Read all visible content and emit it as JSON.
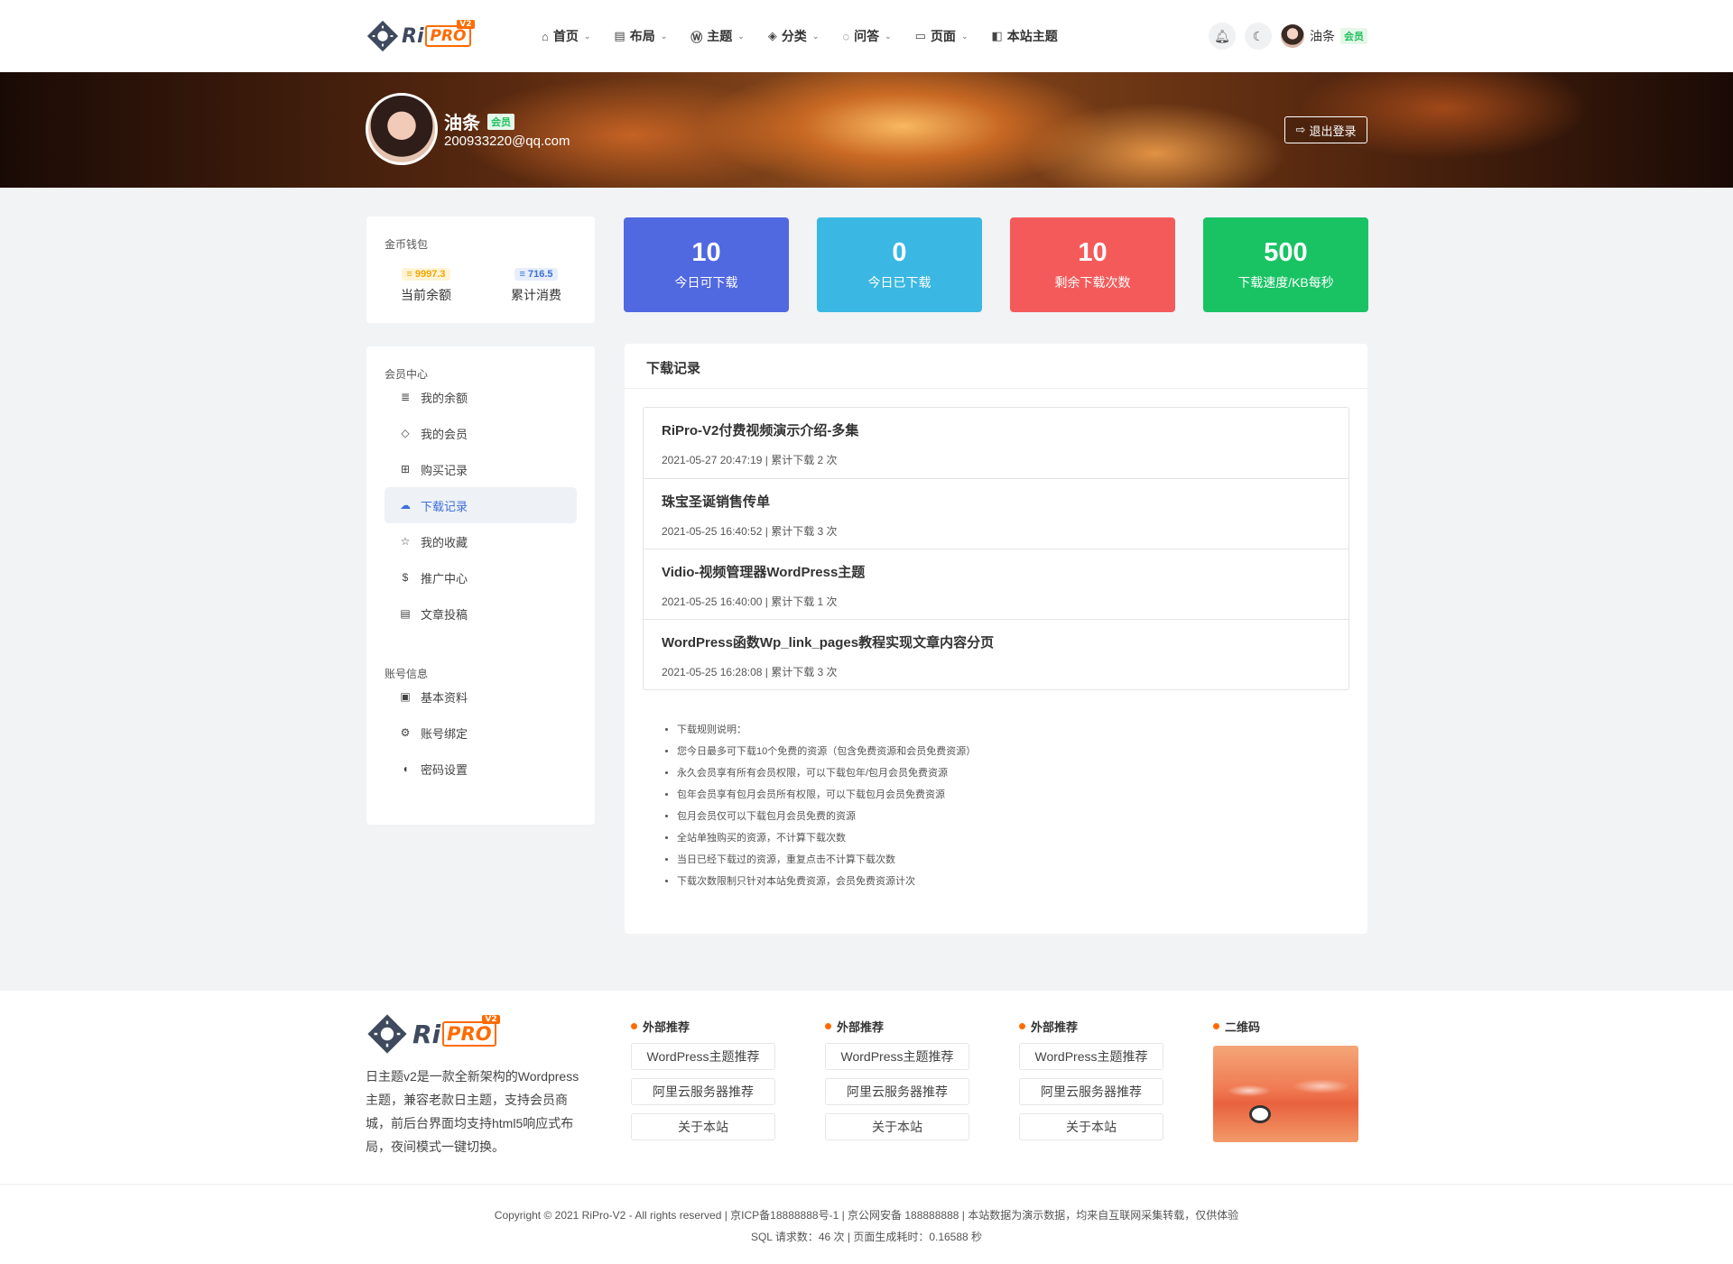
{
  "brand": {
    "ri": "Ri",
    "pro": "PRO",
    "version": "V2"
  },
  "nav": {
    "items": [
      {
        "label": "首页",
        "icon": "home-icon",
        "glyph": "⌂",
        "dropdown": true
      },
      {
        "label": "布局",
        "icon": "file-icon",
        "glyph": "▤",
        "dropdown": true
      },
      {
        "label": "主题",
        "icon": "wordpress-icon",
        "glyph": "Ⓦ",
        "dropdown": true
      },
      {
        "label": "分类",
        "icon": "layers-icon",
        "glyph": "◈",
        "dropdown": true
      },
      {
        "label": "问答",
        "icon": "chat-icon",
        "glyph": "◌",
        "dropdown": true
      },
      {
        "label": "页面",
        "icon": "window-icon",
        "glyph": "▭",
        "dropdown": true
      },
      {
        "label": "本站主题",
        "icon": "bag-icon",
        "glyph": "◧",
        "dropdown": false
      }
    ],
    "user_name": "油条",
    "user_badge": "会员"
  },
  "profile": {
    "name": "油条",
    "badge": "会员",
    "email": "200933220@qq.com",
    "logout_label": "退出登录"
  },
  "wallet": {
    "title": "金币钱包",
    "balance_value": "9997.3",
    "balance_label": "当前余额",
    "spent_value": "716.5",
    "spent_label": "累计消费"
  },
  "sidebar": {
    "member_title": "会员中心",
    "member_items": [
      {
        "label": "我的余额",
        "icon": "coins-icon",
        "glyph": "≣"
      },
      {
        "label": "我的会员",
        "icon": "diamond-icon",
        "glyph": "◇"
      },
      {
        "label": "购买记录",
        "icon": "basket-icon",
        "glyph": "⊞"
      },
      {
        "label": "下载记录",
        "icon": "cloud-download-icon",
        "glyph": "☁"
      },
      {
        "label": "我的收藏",
        "icon": "star-icon",
        "glyph": "☆"
      },
      {
        "label": "推广中心",
        "icon": "hand-coin-icon",
        "glyph": "$"
      },
      {
        "label": "文章投稿",
        "icon": "newspaper-icon",
        "glyph": "▤"
      }
    ],
    "account_title": "账号信息",
    "account_items": [
      {
        "label": "基本资料",
        "icon": "id-card-icon",
        "glyph": "▣"
      },
      {
        "label": "账号绑定",
        "icon": "user-cog-icon",
        "glyph": "⚙"
      },
      {
        "label": "密码设置",
        "icon": "shield-icon",
        "glyph": "◖"
      }
    ]
  },
  "stats": [
    {
      "value": "10",
      "label": "今日可下载",
      "color": "#5068e0"
    },
    {
      "value": "0",
      "label": "今日已下载",
      "color": "#3ab7e2"
    },
    {
      "value": "10",
      "label": "剩余下载次数",
      "color": "#f55a5a"
    },
    {
      "value": "500",
      "label": "下载速度/KB每秒",
      "color": "#19c364"
    }
  ],
  "records": {
    "title": "下载记录",
    "items": [
      {
        "title": "RiPro-V2付费视频演示介绍-多集",
        "meta": "2021-05-27 20:47:19 | 累计下载 2 次"
      },
      {
        "title": "珠宝圣诞销售传单",
        "meta": "2021-05-25 16:40:52 | 累计下载 3 次"
      },
      {
        "title": "Vidio-视频管理器WordPress主题",
        "meta": "2021-05-25 16:40:00 | 累计下载 1 次"
      },
      {
        "title": "WordPress函数Wp_link_pages教程实现文章内容分页",
        "meta": "2021-05-25 16:28:08 | 累计下载 3 次"
      }
    ],
    "rules": [
      "下载规则说明：",
      "您今日最多可下载10个免费的资源（包含免费资源和会员免费资源）",
      "永久会员享有所有会员权限，可以下载包年/包月会员免费资源",
      "包年会员享有包月会员所有权限，可以下载包月会员免费资源",
      "包月会员仅可以下载包月会员免费的资源",
      "全站单独购买的资源，不计算下载次数",
      "当日已经下载过的资源，重复点击不计算下载次数",
      "下载次数限制只针对本站免费资源，会员免费资源计次"
    ]
  },
  "footer": {
    "description": "日主题v2是一款全新架构的Wordpress主题，兼容老款日主题，支持会员商城，前后台界面均支持html5响应式布局，夜间模式一键切换。",
    "columns": [
      {
        "title": "外部推荐",
        "links": [
          "WordPress主题推荐",
          "阿里云服务器推荐",
          "关于本站"
        ]
      },
      {
        "title": "外部推荐",
        "links": [
          "WordPress主题推荐",
          "阿里云服务器推荐",
          "关于本站"
        ]
      },
      {
        "title": "外部推荐",
        "links": [
          "WordPress主题推荐",
          "阿里云服务器推荐",
          "关于本站"
        ]
      }
    ],
    "qr_title": "二维码",
    "copyright": "Copyright © 2021  RiPro-V2  - All rights reserved | 京ICP备18888888号-1  |  京公网安备 188888888  | 本站数据为演示数据，均来自互联网采集转载，仅供体验",
    "sql_info": "SQL 请求数：46 次 | 页面生成耗时：0.16588 秒"
  }
}
